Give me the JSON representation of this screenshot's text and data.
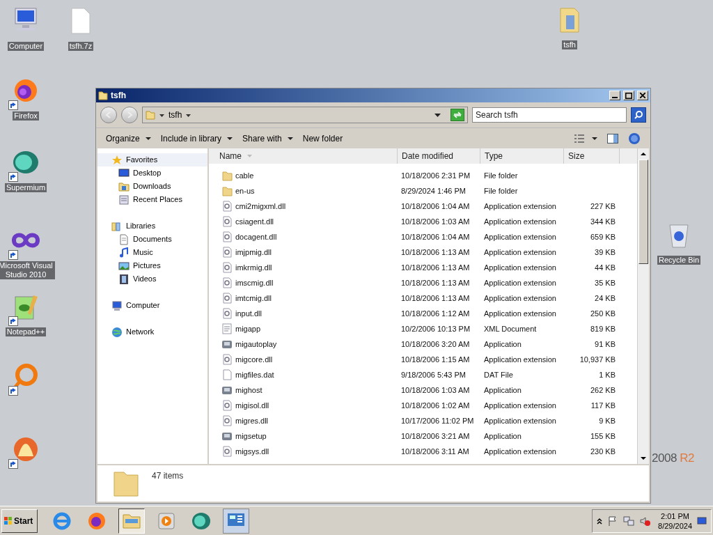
{
  "desktop_icons": [
    {
      "kind": "computer",
      "label": "Computer"
    },
    {
      "kind": "file",
      "label": "tsfh.7z"
    },
    {
      "kind": "folder",
      "label": "tsfh"
    },
    {
      "kind": "firefox",
      "label": "Firefox"
    },
    {
      "kind": "supermium",
      "label": "Supermium"
    },
    {
      "kind": "vs",
      "label": "Microsoft Visual Studio 2010"
    },
    {
      "kind": "notepad",
      "label": "Notepad++"
    },
    {
      "kind": "ring"
    },
    {
      "kind": "bitcomet"
    },
    {
      "kind": "recycle",
      "label": "Recycle Bin"
    }
  ],
  "wallpaper": {
    "version": "2008",
    "edition": "R2"
  },
  "window": {
    "title": "tsfh",
    "address": "tsfh",
    "search": {
      "placeholder": "Search tsfh"
    },
    "toolbar": [
      {
        "label": "Organize",
        "dropdown": true
      },
      {
        "label": "Include in library",
        "dropdown": true
      },
      {
        "label": "Share with",
        "dropdown": true
      },
      {
        "label": "New folder",
        "dropdown": false
      }
    ],
    "nav": [
      {
        "label": "Favorites",
        "kind": "star",
        "selected": true,
        "children": [
          {
            "label": "Desktop",
            "kind": "desktop",
            "selected": false
          },
          {
            "label": "Downloads",
            "kind": "folder",
            "selected": false
          },
          {
            "label": "Recent Places",
            "kind": "recent",
            "selected": false
          }
        ]
      },
      {
        "label": "Libraries",
        "kind": "library",
        "selected": false,
        "children": [
          {
            "label": "Documents",
            "kind": "doc",
            "selected": false
          },
          {
            "label": "Music",
            "kind": "music",
            "selected": false
          },
          {
            "label": "Pictures",
            "kind": "pictures",
            "selected": false
          },
          {
            "label": "Videos",
            "kind": "video",
            "selected": false
          }
        ]
      },
      {
        "label": "Computer",
        "kind": "computer",
        "selected": false
      },
      {
        "label": "Network",
        "kind": "network",
        "selected": false
      }
    ],
    "columns": [
      "Name",
      "Date modified",
      "Type",
      "Size"
    ],
    "rows": [
      {
        "kind": "folder",
        "name": "cable",
        "date": "10/18/2006 2:31 PM",
        "type": "File folder"
      },
      {
        "kind": "folder",
        "name": "en-us",
        "date": "8/29/2024 1:46 PM",
        "type": "File folder"
      },
      {
        "kind": "dll",
        "name": "cmi2migxml.dll",
        "date": "10/18/2006 1:04 AM",
        "type": "Application extension",
        "size": "227 KB"
      },
      {
        "kind": "dll",
        "name": "csiagent.dll",
        "date": "10/18/2006 1:03 AM",
        "type": "Application extension",
        "size": "344 KB"
      },
      {
        "kind": "dll",
        "name": "docagent.dll",
        "date": "10/18/2006 1:04 AM",
        "type": "Application extension",
        "size": "659 KB"
      },
      {
        "kind": "dll",
        "name": "imjpmig.dll",
        "date": "10/18/2006 1:13 AM",
        "type": "Application extension",
        "size": "39 KB"
      },
      {
        "kind": "dll",
        "name": "imkrmig.dll",
        "date": "10/18/2006 1:13 AM",
        "type": "Application extension",
        "size": "44 KB"
      },
      {
        "kind": "dll",
        "name": "imscmig.dll",
        "date": "10/18/2006 1:13 AM",
        "type": "Application extension",
        "size": "35 KB"
      },
      {
        "kind": "dll",
        "name": "imtcmig.dll",
        "date": "10/18/2006 1:13 AM",
        "type": "Application extension",
        "size": "24 KB"
      },
      {
        "kind": "dll",
        "name": "input.dll",
        "date": "10/18/2006 1:12 AM",
        "type": "Application extension",
        "size": "250 KB"
      },
      {
        "kind": "xml",
        "name": "migapp",
        "date": "10/2/2006 10:13 PM",
        "type": "XML Document",
        "size": "819 KB"
      },
      {
        "kind": "app",
        "name": "migautoplay",
        "date": "10/18/2006 3:20 AM",
        "type": "Application",
        "size": "91 KB"
      },
      {
        "kind": "dll",
        "name": "migcore.dll",
        "date": "10/18/2006 1:15 AM",
        "type": "Application extension",
        "size": "10,937 KB"
      },
      {
        "kind": "file",
        "name": "migfiles.dat",
        "date": "9/18/2006 5:43 PM",
        "type": "DAT File",
        "size": "1 KB"
      },
      {
        "kind": "app",
        "name": "mighost",
        "date": "10/18/2006 1:03 AM",
        "type": "Application",
        "size": "262 KB"
      },
      {
        "kind": "dll",
        "name": "migisol.dll",
        "date": "10/18/2006 1:02 AM",
        "type": "Application extension",
        "size": "117 KB"
      },
      {
        "kind": "dll",
        "name": "migres.dll",
        "date": "10/17/2006 11:02 PM",
        "type": "Application extension",
        "size": "9 KB"
      },
      {
        "kind": "app",
        "name": "migsetup",
        "date": "10/18/2006 3:21 AM",
        "type": "Application",
        "size": "155 KB"
      },
      {
        "kind": "dll",
        "name": "migsys.dll",
        "date": "10/18/2006 3:11 AM",
        "type": "Application extension",
        "size": "230 KB"
      }
    ],
    "status": "47 items"
  },
  "taskbar": {
    "start": "Start",
    "apps": [
      {
        "kind": "ie",
        "selected": false
      },
      {
        "kind": "firefox",
        "selected": false
      },
      {
        "kind": "explorer",
        "selected": true
      },
      {
        "kind": "media",
        "selected": false
      },
      {
        "kind": "supermium",
        "selected": false
      },
      {
        "kind": "control",
        "selected": false
      }
    ],
    "time": "2:01 PM",
    "date": "8/29/2024"
  }
}
